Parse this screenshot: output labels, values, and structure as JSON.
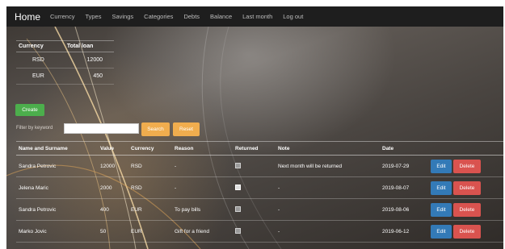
{
  "navbar": {
    "brand": "Home",
    "links": [
      "Currency",
      "Types",
      "Savings",
      "Categories",
      "Debts",
      "Balance",
      "Last month",
      "Log out"
    ]
  },
  "summary": {
    "headers": [
      "Currency",
      "Total loan"
    ],
    "rows": [
      {
        "currency": "RSD",
        "total": "12000"
      },
      {
        "currency": "EUR",
        "total": "450"
      }
    ]
  },
  "actions": {
    "create_label": "Create",
    "filter_label": "Filter by keyword",
    "filter_value": "",
    "search_label": "Search",
    "reset_label": "Reset"
  },
  "table": {
    "headers": [
      "Name and Surname",
      "Value",
      "Currency",
      "Reason",
      "Returned",
      "Note",
      "Date",
      ""
    ],
    "rows": [
      {
        "name": "Sandra Petrovic",
        "value": "12000",
        "currency": "RSD",
        "reason": "-",
        "returned": false,
        "note": "Next month will be returned",
        "date": "2019-07-29"
      },
      {
        "name": "Jelena Maric",
        "value": "2000",
        "currency": "RSD",
        "reason": "-",
        "returned": true,
        "note": "-",
        "date": "2019-08-07"
      },
      {
        "name": "Sandra Petrovic",
        "value": "400",
        "currency": "EUR",
        "reason": "To pay bills",
        "returned": false,
        "note": "-",
        "date": "2019-08-06"
      },
      {
        "name": "Marko Jovic",
        "value": "50",
        "currency": "EUR",
        "reason": "Gift for a friend",
        "returned": false,
        "note": "-",
        "date": "2019-06-12"
      }
    ],
    "edit_label": "Edit",
    "delete_label": "Delete"
  },
  "colors": {
    "navbar": "#1e1e1e",
    "create": "#4cae4c",
    "search_reset": "#f0ad4e",
    "edit": "#337ab7",
    "delete": "#d9534f"
  }
}
